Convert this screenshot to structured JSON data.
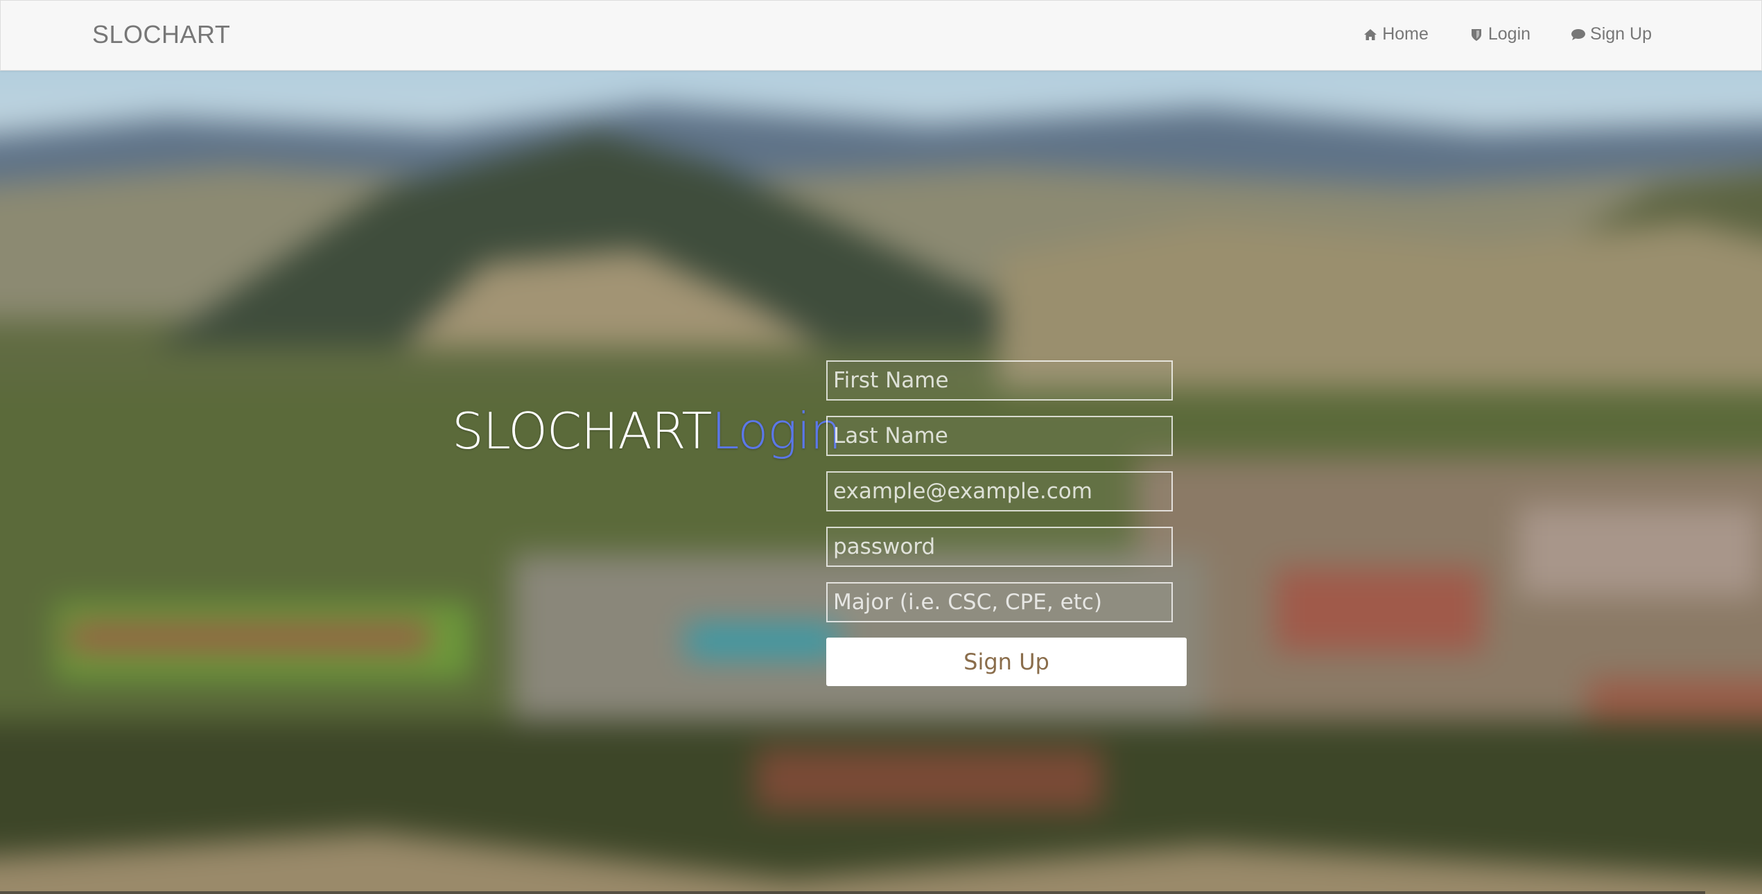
{
  "navbar": {
    "brand": "SLOCHART",
    "links": [
      {
        "label": "Home",
        "icon": "home-icon"
      },
      {
        "label": "Login",
        "icon": "shield-icon"
      },
      {
        "label": "Sign Up",
        "icon": "comment-icon"
      }
    ]
  },
  "hero": {
    "title_primary": "SLOCHART",
    "title_accent": "Login",
    "accent_color": "#5b77e8"
  },
  "form": {
    "first_name_placeholder": "First Name",
    "last_name_placeholder": "Last Name",
    "email_placeholder": "example@example.com",
    "password_placeholder": "password",
    "major_placeholder": "Major (i.e. CSC, CPE, etc)",
    "submit_label": "Sign Up"
  }
}
